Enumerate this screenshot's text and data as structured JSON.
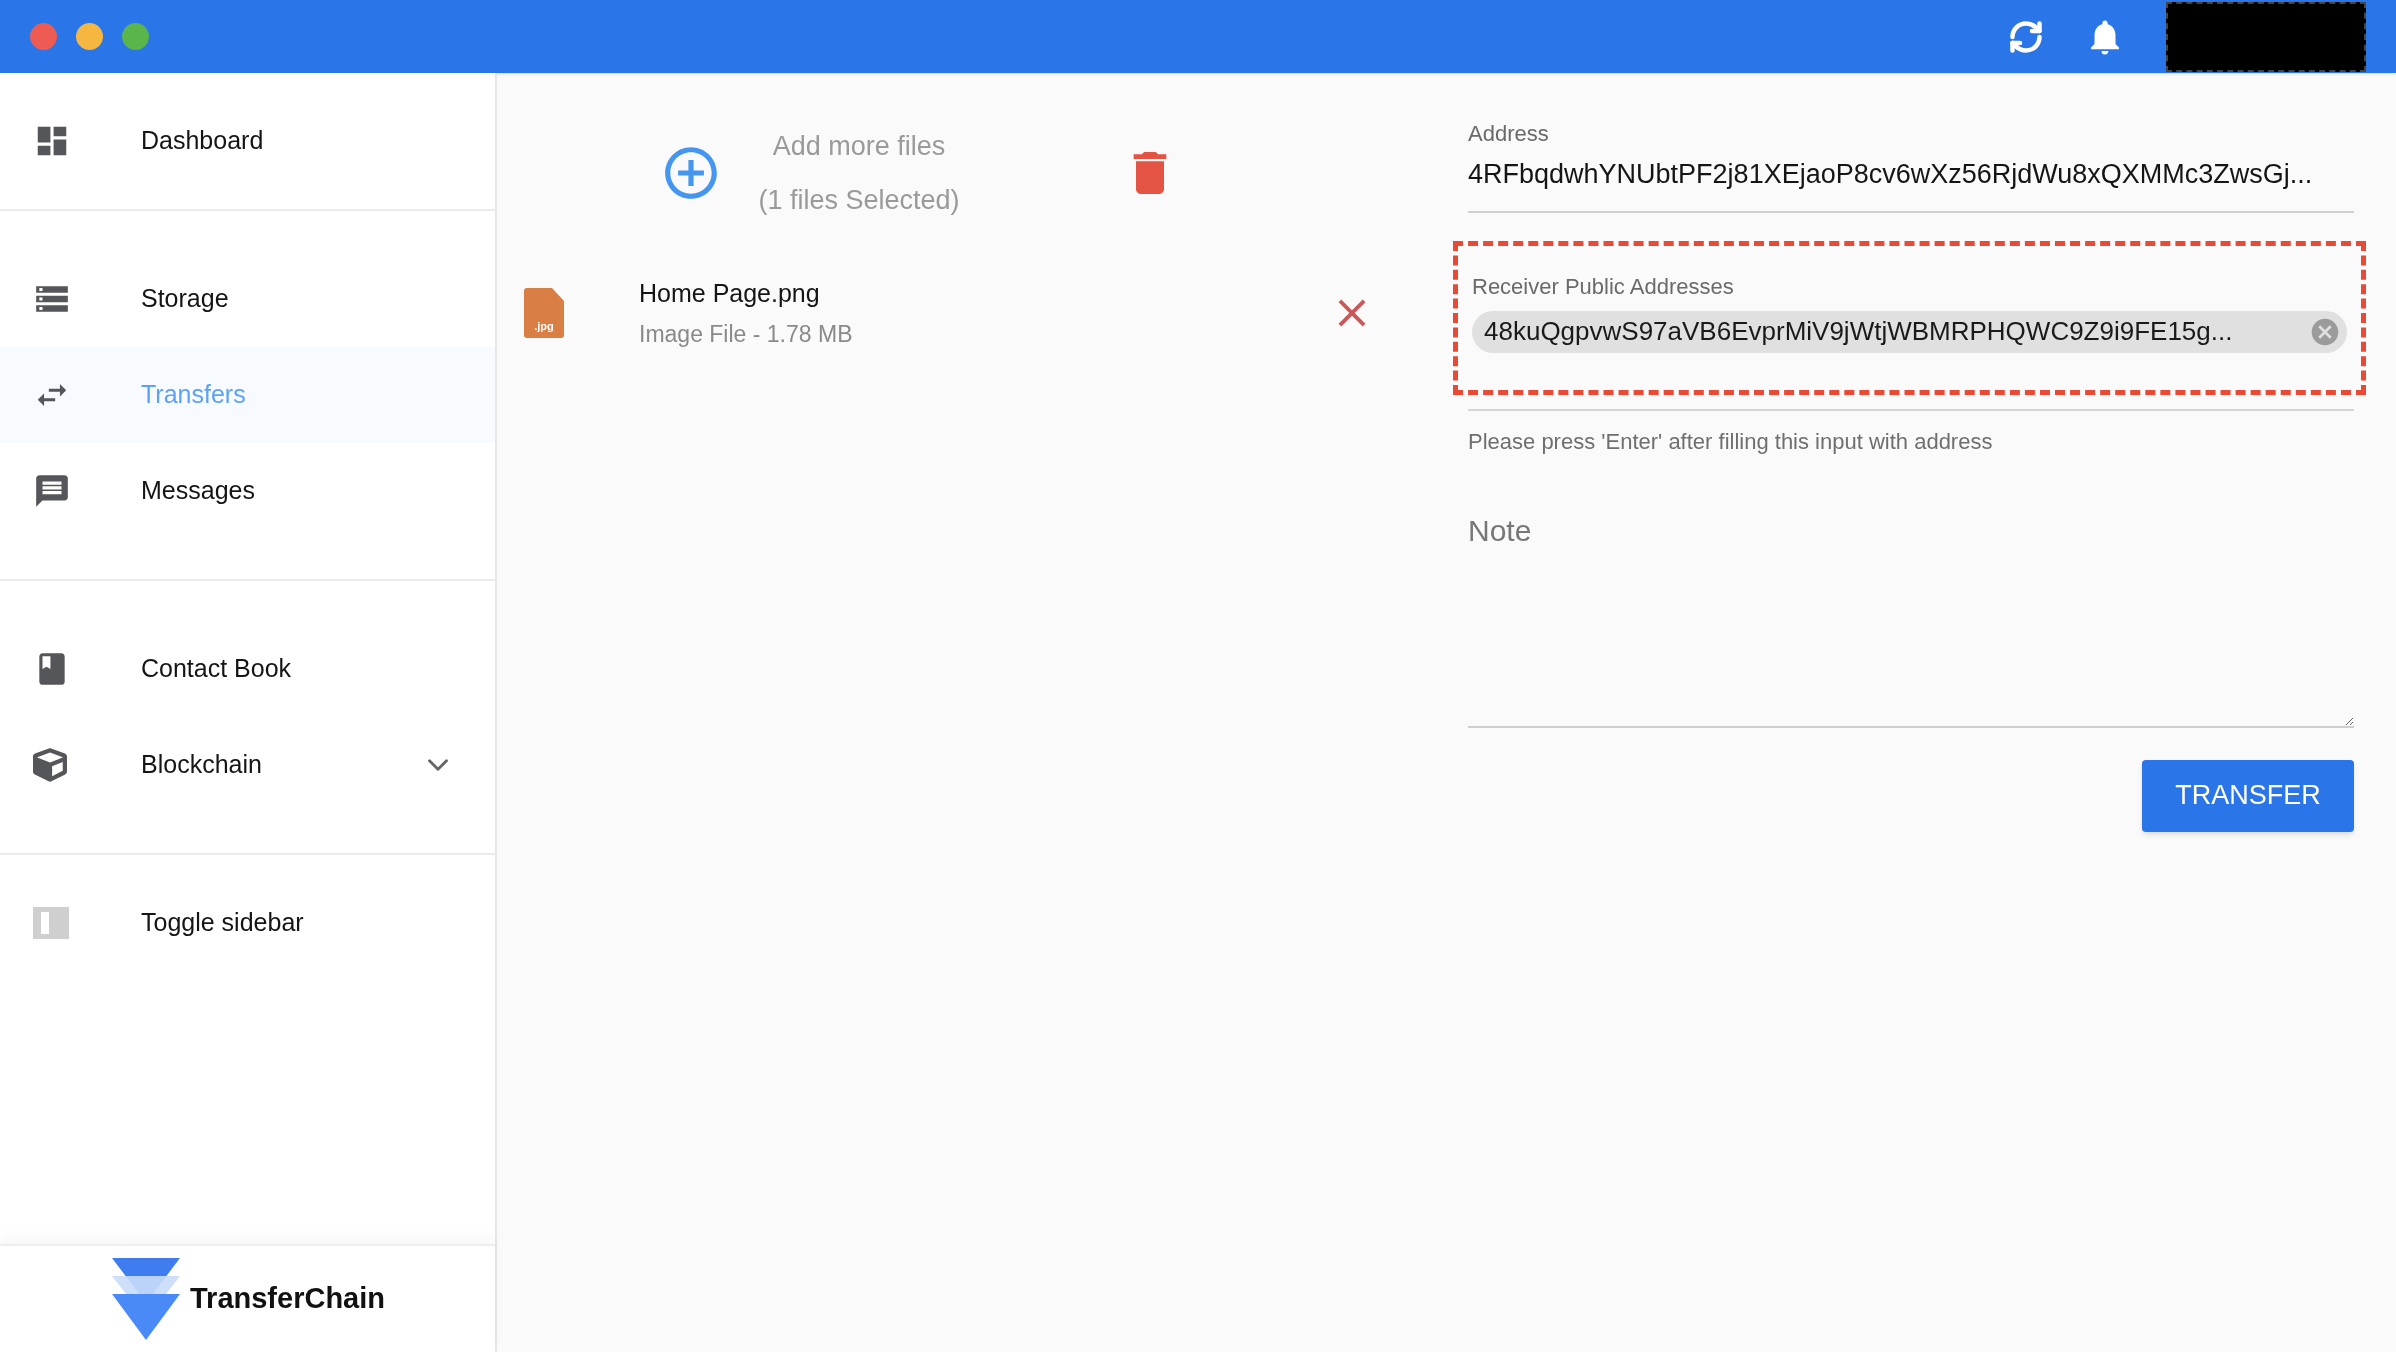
{
  "sidebar": {
    "sections": [
      [
        {
          "label": "Dashboard",
          "selected": false,
          "kind": "link"
        }
      ],
      [
        {
          "label": "Storage",
          "selected": false,
          "kind": "link"
        },
        {
          "label": "Transfers",
          "selected": true,
          "kind": "link"
        },
        {
          "label": "Messages",
          "selected": false,
          "kind": "link"
        }
      ],
      [
        {
          "label": "Contact Book",
          "selected": false,
          "kind": "link"
        },
        {
          "label": "Blockchain",
          "selected": false,
          "kind": "expandable",
          "expanded": false
        }
      ],
      [
        {
          "label": "Toggle sidebar",
          "selected": false,
          "kind": "link"
        }
      ]
    ],
    "brand": "TransferChain"
  },
  "files": {
    "add_label": "Add more files",
    "count": "(1 files Selected)",
    "items": [
      {
        "badge": ".jpg",
        "name": "Home Page.png",
        "meta": "Image File - 1.78 MB"
      }
    ]
  },
  "form": {
    "address": {
      "label": "Address",
      "value": "4RFbqdwhYNUbtPF2j81XEjaoP8cv6wXz56RjdWu8xQXMMc3ZwsGj..."
    },
    "receivers": {
      "label": "Receiver Public Addresses",
      "chips": [
        "48kuQgpvwS97aVB6EvprMiV9jWtjWBMRPHQWC9Z9i9FE15g..."
      ],
      "highlighted": true
    },
    "help": "Please press 'Enter' after filling this input with address",
    "note": {
      "placeholder": "Note"
    },
    "submit": "TRANSFER"
  }
}
